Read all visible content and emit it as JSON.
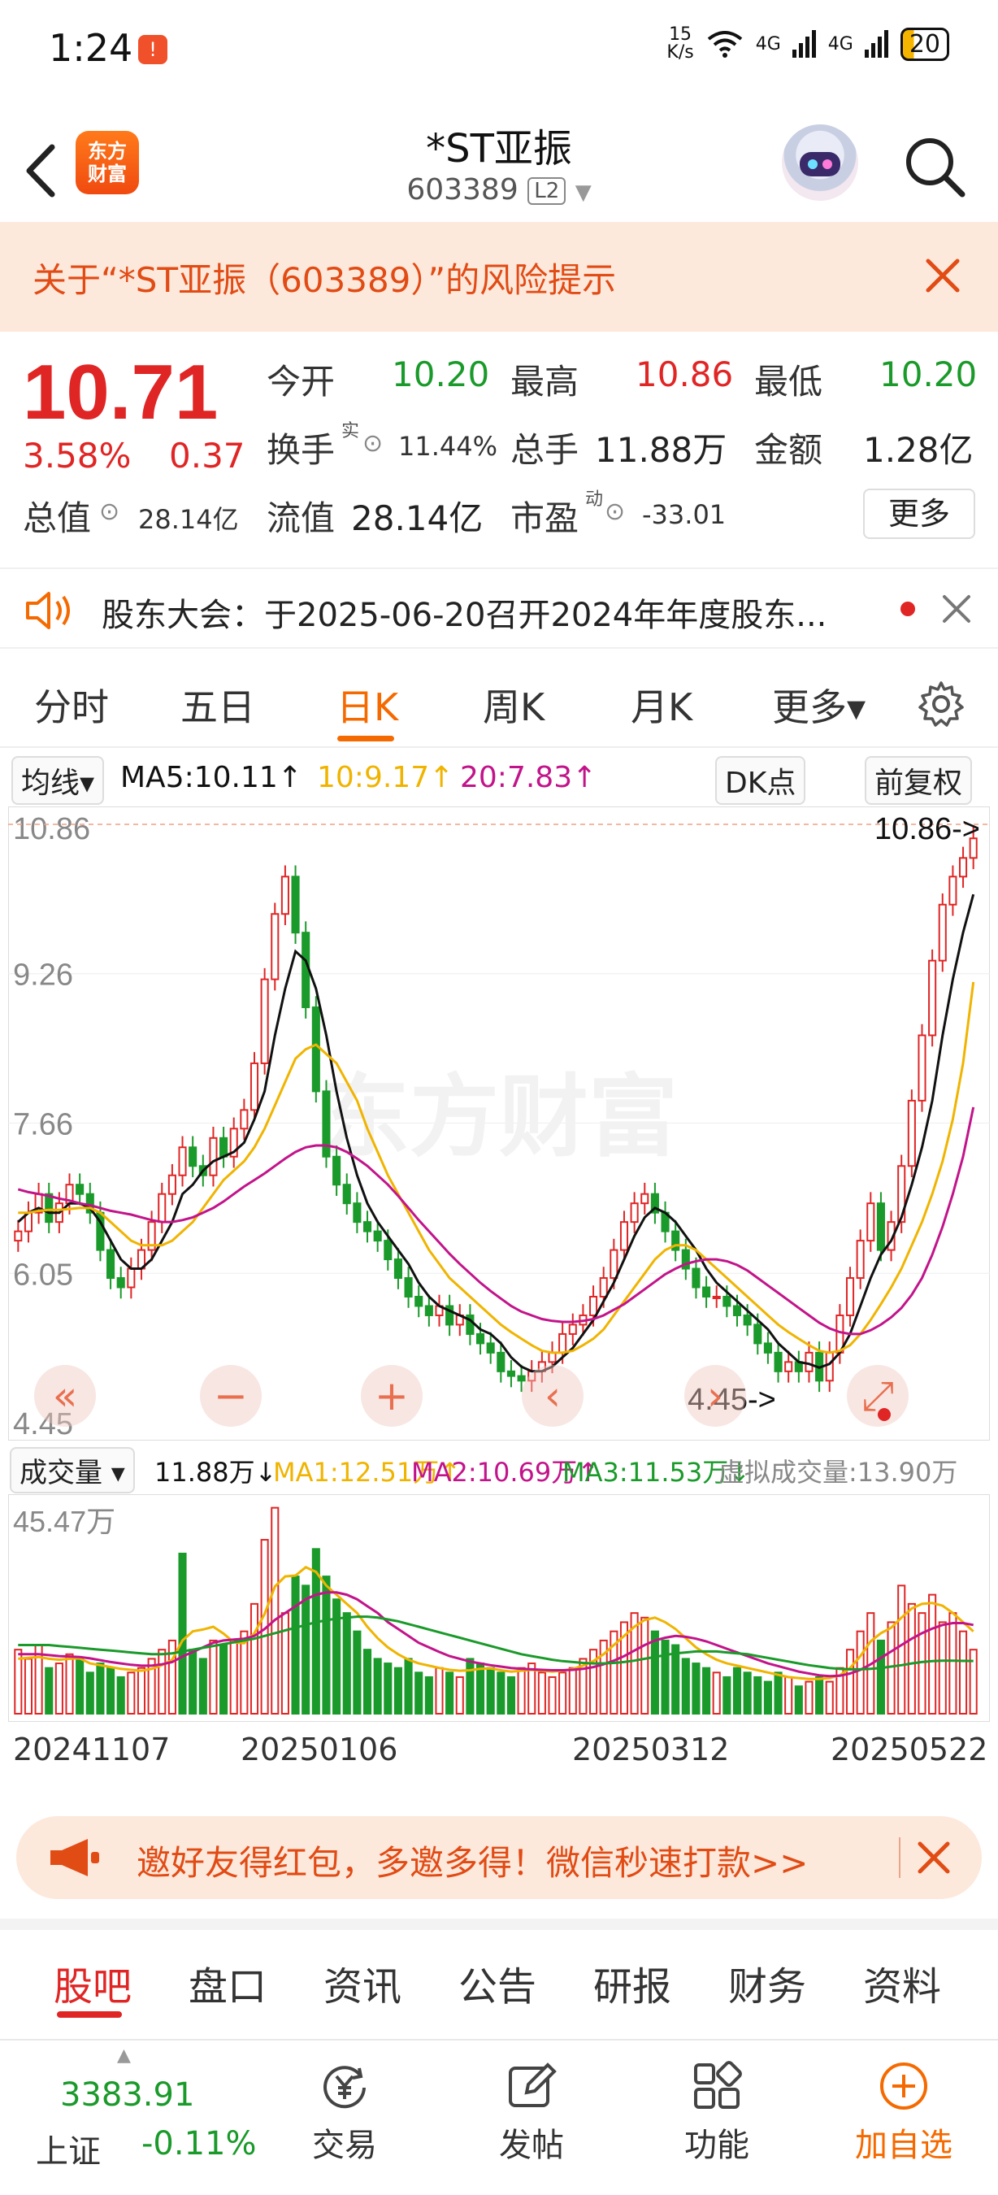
{
  "status_bar": {
    "time": "1:24",
    "badge": "!",
    "net_speed": "15\nK/s",
    "signal1": "4G",
    "signal2": "4G",
    "battery": "20"
  },
  "header": {
    "logo_line1": "东方",
    "logo_line2": "财富",
    "title": "*ST亚振",
    "code": "603389",
    "level_badge": "L2"
  },
  "risk_banner": {
    "text": "关于“*ST亚振（603389）”的风险提示"
  },
  "quote": {
    "price": "10.71",
    "change_pct": "3.58%",
    "change": "0.37",
    "open_label": "今开",
    "open": "10.20",
    "high_label": "最高",
    "high": "10.86",
    "low_label": "最低",
    "low": "10.20",
    "turnover_label": "换手",
    "turnover_sup": "实",
    "turnover": "11.44%",
    "volume_label": "总手",
    "volume": "11.88万",
    "amount_label": "金额",
    "amount": "1.28亿",
    "mktcap_label": "总值",
    "mktcap": "28.14亿",
    "float_label": "流值",
    "float": "28.14亿",
    "pe_label": "市盈",
    "pe_sup": "动",
    "pe": "-33.01",
    "more": "更多"
  },
  "notice": {
    "text": "股东大会：于2025-06-20召开2024年年度股东..."
  },
  "period_tabs": [
    {
      "label": "分时"
    },
    {
      "label": "五日"
    },
    {
      "label": "日K"
    },
    {
      "label": "周K"
    },
    {
      "label": "月K"
    },
    {
      "label": "更多▾"
    }
  ],
  "ma_row": {
    "selector": "均线▾",
    "ma5": "MA5:10.11↑",
    "ma10": "10:9.17↑",
    "ma20": "20:7.83↑",
    "dk": "DK点",
    "adjust": "前复权"
  },
  "colors": {
    "up": "#e02525",
    "down": "#1a9a2a",
    "ma5": "#111111",
    "ma10": "#f0b400",
    "ma20": "#c2148a",
    "accent": "#f56a00"
  },
  "chart_data": [
    {
      "type": "candlestick",
      "y_ticks": [
        "10.86",
        "9.26",
        "7.66",
        "6.05",
        "4.45"
      ],
      "ylim": [
        4.45,
        10.86
      ],
      "max_label": "10.86->",
      "min_label": "4.45->",
      "watermark": "东方财富",
      "close": [
        6.5,
        6.7,
        6.9,
        6.6,
        6.8,
        7.0,
        6.9,
        6.7,
        6.3,
        6.0,
        5.9,
        6.1,
        6.3,
        6.6,
        6.9,
        7.1,
        7.4,
        7.2,
        7.1,
        7.5,
        7.3,
        7.6,
        7.8,
        8.3,
        9.2,
        9.9,
        10.3,
        9.7,
        8.9,
        8.0,
        7.3,
        7.0,
        6.8,
        6.6,
        6.5,
        6.4,
        6.2,
        6.0,
        5.8,
        5.7,
        5.6,
        5.7,
        5.5,
        5.6,
        5.4,
        5.3,
        5.2,
        5.0,
        4.95,
        4.9,
        5.0,
        5.1,
        5.2,
        5.4,
        5.5,
        5.6,
        5.8,
        6.0,
        6.3,
        6.6,
        6.8,
        6.9,
        6.7,
        6.5,
        6.3,
        6.1,
        5.9,
        5.8,
        5.8,
        5.7,
        5.6,
        5.5,
        5.3,
        5.2,
        5.0,
        5.1,
        5.0,
        5.2,
        4.9,
        5.2,
        5.6,
        6.0,
        6.4,
        6.8,
        6.3,
        6.6,
        7.2,
        7.9,
        8.6,
        9.4,
        10.0,
        10.3,
        10.5,
        10.71
      ],
      "ma5": [
        6.6,
        6.7,
        6.75,
        6.7,
        6.7,
        6.8,
        6.8,
        6.75,
        6.6,
        6.4,
        6.2,
        6.1,
        6.1,
        6.2,
        6.4,
        6.6,
        6.9,
        7.0,
        7.15,
        7.25,
        7.3,
        7.35,
        7.45,
        7.7,
        8.0,
        8.6,
        9.1,
        9.5,
        9.4,
        9.1,
        8.6,
        8.0,
        7.5,
        7.1,
        6.8,
        6.6,
        6.45,
        6.3,
        6.15,
        5.95,
        5.8,
        5.7,
        5.65,
        5.6,
        5.55,
        5.45,
        5.4,
        5.3,
        5.15,
        5.05,
        5.0,
        5.0,
        5.05,
        5.15,
        5.25,
        5.4,
        5.55,
        5.75,
        5.95,
        6.2,
        6.45,
        6.65,
        6.75,
        6.7,
        6.6,
        6.45,
        6.3,
        6.1,
        5.95,
        5.85,
        5.75,
        5.65,
        5.55,
        5.45,
        5.3,
        5.2,
        5.1,
        5.08,
        5.04,
        5.08,
        5.2,
        5.4,
        5.7,
        6.0,
        6.25,
        6.4,
        6.65,
        7.0,
        7.4,
        7.9,
        8.6,
        9.2,
        9.7,
        10.11
      ],
      "ma10": [
        6.7,
        6.7,
        6.72,
        6.73,
        6.73,
        6.74,
        6.75,
        6.75,
        6.7,
        6.6,
        6.5,
        6.4,
        6.35,
        6.35,
        6.35,
        6.4,
        6.5,
        6.6,
        6.75,
        6.9,
        7.05,
        7.15,
        7.25,
        7.4,
        7.6,
        7.85,
        8.1,
        8.35,
        8.45,
        8.5,
        8.4,
        8.3,
        8.1,
        7.9,
        7.6,
        7.35,
        7.1,
        6.9,
        6.7,
        6.5,
        6.3,
        6.15,
        6.0,
        5.9,
        5.8,
        5.7,
        5.6,
        5.5,
        5.42,
        5.35,
        5.28,
        5.22,
        5.2,
        5.2,
        5.22,
        5.28,
        5.35,
        5.45,
        5.6,
        5.75,
        5.9,
        6.05,
        6.2,
        6.3,
        6.35,
        6.35,
        6.3,
        6.2,
        6.1,
        6.0,
        5.9,
        5.8,
        5.7,
        5.6,
        5.5,
        5.42,
        5.35,
        5.28,
        5.22,
        5.2,
        5.22,
        5.28,
        5.4,
        5.55,
        5.72,
        5.9,
        6.1,
        6.35,
        6.6,
        6.9,
        7.25,
        7.7,
        8.3,
        9.17
      ],
      "ma20": [
        6.95,
        6.92,
        6.9,
        6.88,
        6.85,
        6.83,
        6.8,
        6.78,
        6.75,
        6.72,
        6.7,
        6.68,
        6.65,
        6.62,
        6.6,
        6.6,
        6.62,
        6.65,
        6.7,
        6.75,
        6.82,
        6.9,
        6.98,
        7.05,
        7.12,
        7.2,
        7.28,
        7.35,
        7.4,
        7.42,
        7.42,
        7.4,
        7.35,
        7.28,
        7.2,
        7.1,
        7.0,
        6.88,
        6.75,
        6.62,
        6.5,
        6.38,
        6.26,
        6.15,
        6.05,
        5.95,
        5.86,
        5.78,
        5.7,
        5.64,
        5.6,
        5.56,
        5.54,
        5.53,
        5.53,
        5.54,
        5.56,
        5.6,
        5.66,
        5.72,
        5.8,
        5.88,
        5.96,
        6.04,
        6.1,
        6.15,
        6.18,
        6.2,
        6.2,
        6.18,
        6.14,
        6.08,
        6.0,
        5.92,
        5.84,
        5.76,
        5.68,
        5.6,
        5.52,
        5.46,
        5.42,
        5.4,
        5.4,
        5.44,
        5.5,
        5.58,
        5.68,
        5.82,
        6.0,
        6.25,
        6.55,
        6.9,
        7.3,
        7.83
      ]
    },
    {
      "type": "bar",
      "name": "成交量",
      "y_ticks": [
        "45.47万"
      ],
      "ylim": [
        0,
        45.47
      ],
      "values": [
        14,
        12,
        15,
        10,
        11,
        13,
        12,
        9,
        11,
        10,
        8,
        9,
        10,
        12,
        14,
        16,
        35,
        14,
        12,
        16,
        15,
        16,
        18,
        24,
        38,
        45,
        22,
        30,
        28,
        36,
        30,
        25,
        22,
        18,
        14,
        12,
        11,
        10,
        12,
        9,
        8,
        10,
        9,
        8,
        12,
        11,
        10,
        9,
        8,
        10,
        11,
        9,
        8,
        9,
        10,
        12,
        14,
        16,
        18,
        20,
        22,
        21,
        18,
        16,
        15,
        12,
        11,
        10,
        9,
        8,
        10,
        9,
        8,
        7,
        9,
        8,
        6,
        7,
        8,
        7,
        10,
        14,
        18,
        22,
        16,
        20,
        28,
        24,
        22,
        26,
        20,
        22,
        18,
        14
      ],
      "up": [
        true,
        true,
        true,
        false,
        true,
        true,
        false,
        false,
        false,
        false,
        false,
        true,
        true,
        true,
        true,
        true,
        false,
        false,
        false,
        true,
        false,
        true,
        true,
        true,
        true,
        true,
        true,
        false,
        false,
        false,
        false,
        false,
        false,
        false,
        false,
        false,
        false,
        false,
        false,
        false,
        false,
        true,
        false,
        true,
        false,
        false,
        false,
        false,
        false,
        true,
        true,
        true,
        true,
        true,
        true,
        true,
        true,
        true,
        true,
        true,
        true,
        true,
        false,
        false,
        false,
        false,
        false,
        false,
        true,
        false,
        false,
        false,
        false,
        false,
        false,
        true,
        false,
        true,
        false,
        true,
        true,
        true,
        true,
        true,
        false,
        true,
        true,
        true,
        true,
        true,
        true,
        true,
        true,
        true
      ],
      "ma1": [
        12,
        12.2,
        12.4,
        12,
        11.8,
        12,
        12.1,
        11,
        10.6,
        10.2,
        9.8,
        9.6,
        9.4,
        9.8,
        10.6,
        11.8,
        16,
        18,
        18.4,
        19,
        17.5,
        15.6,
        15.4,
        17.6,
        21.8,
        27.8,
        30,
        30.2,
        32,
        31,
        28,
        26,
        24,
        22,
        19,
        16.5,
        14.5,
        13,
        11.8,
        11,
        10.5,
        10,
        9.6,
        9.4,
        9.5,
        9.8,
        9.9,
        9.5,
        9.2,
        9.4,
        9.6,
        9.4,
        9.2,
        9.4,
        9.8,
        10.5,
        11.5,
        13,
        15,
        17,
        19,
        20.5,
        21,
        20,
        18.5,
        16.5,
        14.5,
        13,
        11.8,
        11,
        10.5,
        10,
        9.5,
        9,
        8.5,
        8,
        7.8,
        7.6,
        7.6,
        7.8,
        8.4,
        10,
        12.6,
        15.8,
        17.6,
        18.8,
        21,
        23,
        24,
        24.2,
        23.6,
        22,
        20,
        18
      ],
      "ma2": [
        13,
        13,
        13,
        12.8,
        12.6,
        12.5,
        12.4,
        12.1,
        11.7,
        11.3,
        11,
        10.7,
        10.5,
        10.5,
        10.8,
        11.3,
        12.5,
        13.5,
        14.5,
        15.5,
        16,
        16.2,
        16.4,
        17,
        18.5,
        20.5,
        22,
        23.5,
        25,
        26,
        26.5,
        26.5,
        26,
        25,
        23.5,
        22,
        20,
        18.5,
        17,
        15.5,
        14.5,
        13.5,
        12.6,
        12,
        11.4,
        11,
        10.6,
        10.3,
        10,
        9.8,
        9.7,
        9.6,
        9.5,
        9.5,
        9.6,
        9.8,
        10.2,
        10.8,
        11.6,
        12.6,
        13.8,
        15,
        16,
        16.6,
        17,
        16.8,
        16.4,
        15.8,
        15,
        14.2,
        13.4,
        12.6,
        11.8,
        11,
        10.4,
        9.8,
        9.2,
        8.8,
        8.4,
        8.2,
        8.3,
        8.8,
        9.6,
        10.8,
        12.2,
        13.6,
        15,
        16.4,
        17.6,
        18.6,
        19.4,
        19.8,
        19.8,
        19.4
      ],
      "ma3": [
        15,
        15,
        15,
        15,
        14.8,
        14.6,
        14.4,
        14.2,
        14,
        13.8,
        13.6,
        13.4,
        13.2,
        13,
        13,
        13.2,
        13.6,
        14,
        14.4,
        14.8,
        15.2,
        15.6,
        16,
        16.4,
        17,
        17.6,
        18.2,
        18.8,
        19.4,
        20,
        20.4,
        20.8,
        21,
        21.2,
        21.2,
        21,
        20.6,
        20.2,
        19.6,
        19,
        18.4,
        17.8,
        17.2,
        16.6,
        16,
        15.4,
        14.8,
        14.2,
        13.6,
        13,
        12.6,
        12.2,
        11.8,
        11.5,
        11.3,
        11.1,
        11,
        11,
        11.1,
        11.3,
        11.6,
        12,
        12.4,
        12.8,
        13.2,
        13.4,
        13.6,
        13.6,
        13.6,
        13.4,
        13.2,
        13,
        12.6,
        12.2,
        11.8,
        11.4,
        11,
        10.6,
        10.3,
        10,
        9.8,
        9.7,
        9.7,
        9.8,
        10,
        10.3,
        10.6,
        11,
        11.3,
        11.5,
        11.6,
        11.6,
        11.55,
        11.53
      ]
    }
  ],
  "volume_row": {
    "selector": "成交量 ▾",
    "vol": "11.88万↓",
    "ma1": "MA1:12.51万↑",
    "ma2": "MA2:10.69万↑",
    "ma3": "MA3:11.53万↓",
    "virtual": "虚拟成交量:13.90万"
  },
  "x_dates": [
    "20241107",
    "20250106",
    "20250312",
    "20250522"
  ],
  "invite": {
    "text": "邀好友得红包，多邀多得！微信秒速打款>>"
  },
  "section_tabs": [
    {
      "label": "股吧"
    },
    {
      "label": "盘口"
    },
    {
      "label": "资讯"
    },
    {
      "label": "公告"
    },
    {
      "label": "研报"
    },
    {
      "label": "财务"
    },
    {
      "label": "资料"
    }
  ],
  "bottom_nav": {
    "index_value": "3383.91",
    "index_name": "上证",
    "index_change": "-0.11%",
    "trade": "交易",
    "post": "发帖",
    "functions": "功能",
    "add_watch": "加自选"
  }
}
